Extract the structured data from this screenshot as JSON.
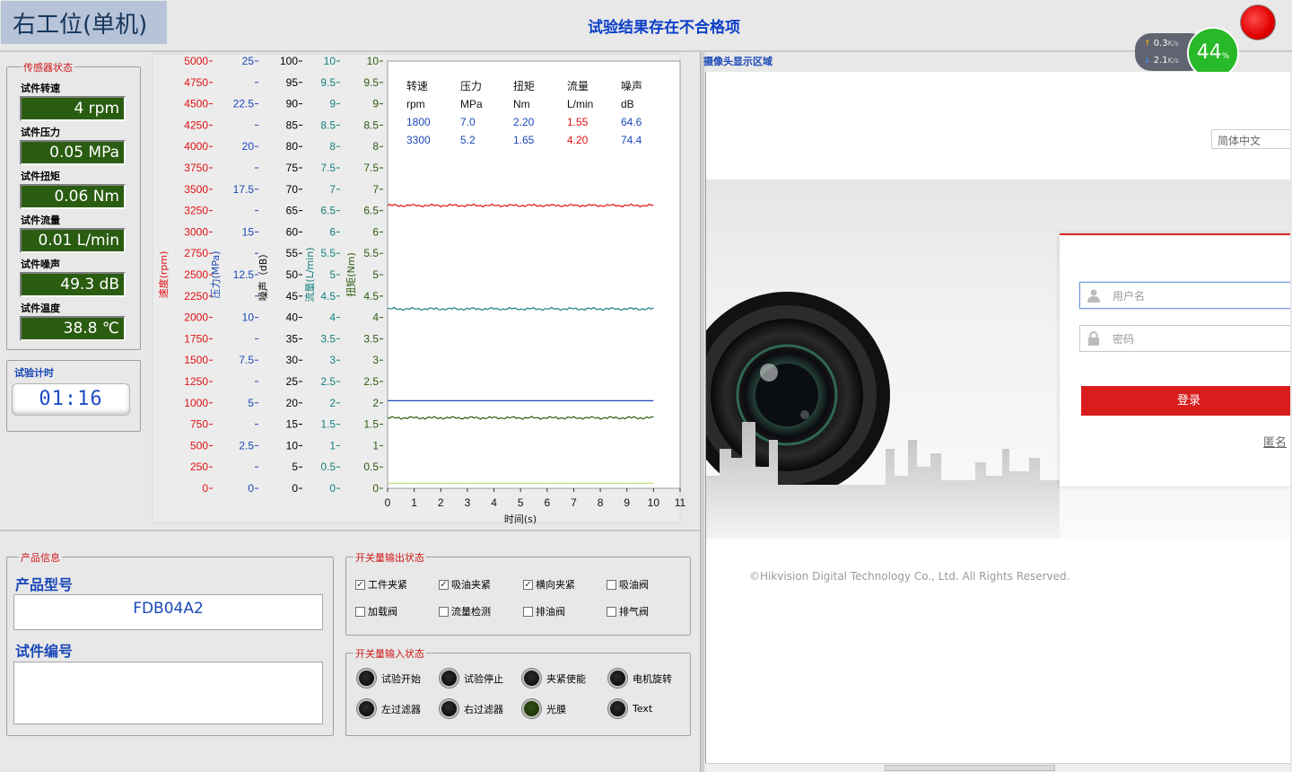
{
  "header": {
    "title": "右工位(单机)",
    "result_message": "试验结果存在不合格项"
  },
  "net_widget": {
    "up": "0.3",
    "up_unit": "K/s",
    "down": "2.1",
    "down_unit": "K/s",
    "percent": "44",
    "percent_unit": "%"
  },
  "sensor": {
    "legend": "传感器状态",
    "items": [
      {
        "label": "试件转速",
        "value": "4 rpm"
      },
      {
        "label": "试件压力",
        "value": "0.05 MPa"
      },
      {
        "label": "试件扭矩",
        "value": "0.06 Nm"
      },
      {
        "label": "试件流量",
        "value": "0.01 L/min"
      },
      {
        "label": "试件噪声",
        "value": "49.3 dB"
      },
      {
        "label": "试件温度",
        "value": "38.8 ℃"
      }
    ]
  },
  "timer": {
    "label": "试验计时",
    "value": "01:16"
  },
  "chart_data": {
    "type": "line",
    "xlabel": "时间(s)",
    "xlim": [
      0,
      11
    ],
    "x_ticks": [
      "0",
      "1",
      "2",
      "3",
      "4",
      "5",
      "6",
      "7",
      "8",
      "9",
      "10",
      "11"
    ],
    "axes": [
      {
        "label": "速度(rpm)",
        "color": "#e01010",
        "min": 0,
        "max": 5000,
        "ticks": [
          "5000",
          "4750",
          "4500",
          "4250",
          "4000",
          "3750",
          "3500",
          "3250",
          "3000",
          "2750",
          "2500",
          "2250",
          "2000",
          "1750",
          "1500",
          "1250",
          "1000",
          "750",
          "500",
          "250",
          "0"
        ]
      },
      {
        "label": "压力(MPa)",
        "color": "#1a48b8",
        "min": 0,
        "max": 25,
        "ticks": [
          "25",
          "",
          "22.5",
          "",
          "20",
          "",
          "17.5",
          "",
          "15",
          "",
          "12.5",
          "",
          "10",
          "",
          "7.5",
          "",
          "5",
          "",
          "2.5",
          "",
          "0"
        ]
      },
      {
        "label": "噪声（dB）",
        "color": "#000000",
        "min": 0,
        "max": 100,
        "ticks": [
          "100",
          "95",
          "90",
          "85",
          "80",
          "75",
          "70",
          "65",
          "60",
          "55",
          "50",
          "45",
          "40",
          "35",
          "30",
          "25",
          "20",
          "15",
          "10",
          "5",
          "0"
        ]
      },
      {
        "label": "流量(L/min)",
        "color": "#168080",
        "min": 0,
        "max": 10,
        "ticks": [
          "10",
          "9.5",
          "9",
          "8.5",
          "8",
          "7.5",
          "7",
          "6.5",
          "6",
          "5.5",
          "5",
          "4.5",
          "4",
          "3.5",
          "3",
          "2.5",
          "2",
          "1.5",
          "1",
          "0.5",
          "0"
        ]
      },
      {
        "label": "扭矩(Nm)",
        "color": "#2c5a10",
        "min": 0,
        "max": 10,
        "ticks": [
          "10",
          "9.5",
          "9",
          "8.5",
          "8",
          "7.5",
          "7",
          "6.5",
          "6",
          "5.5",
          "5",
          "4.5",
          "4",
          "3.5",
          "3",
          "2.5",
          "2",
          "1.5",
          "1",
          "0.5",
          "0"
        ]
      }
    ],
    "series": [
      {
        "color": "#e01010",
        "axis": 3,
        "x": [
          0,
          10
        ],
        "y": [
          6.62,
          6.62
        ],
        "noisy": true
      },
      {
        "color": "#168080",
        "axis": 3,
        "x": [
          0,
          10
        ],
        "y": [
          4.2,
          4.2
        ],
        "noisy": true
      },
      {
        "color": "#1a48b8",
        "axis": 3,
        "x": [
          0,
          10
        ],
        "y": [
          2.05,
          2.05
        ],
        "noisy": false
      },
      {
        "color": "#2c5a10",
        "axis": 3,
        "x": [
          0,
          10
        ],
        "y": [
          1.65,
          1.65
        ],
        "noisy": true
      },
      {
        "color": "#b8e070",
        "axis": 3,
        "x": [
          0,
          10
        ],
        "y": [
          0.12,
          0.12
        ],
        "noisy": false
      }
    ],
    "table": {
      "headers": [
        "转速",
        "压力",
        "扭矩",
        "流量",
        "噪声"
      ],
      "units": [
        "rpm",
        "MPa",
        "Nm",
        "L/min",
        "dB"
      ],
      "rows": [
        [
          "1800",
          "7.0",
          "2.20",
          "1.55",
          "64.6"
        ],
        [
          "3300",
          "5.2",
          "1.65",
          "4.20",
          "74.4"
        ]
      ],
      "colors": [
        "#1a48b8",
        "#1a48b8",
        "#1a48b8",
        "#e01010",
        "#1a48b8"
      ]
    },
    "grid": false
  },
  "product": {
    "legend": "产品信息",
    "model_label": "产品型号",
    "model_value": "FDB04A2",
    "serial_label": "试件编号",
    "serial_value": ""
  },
  "outputs": {
    "legend": "开关量输出状态",
    "items": [
      {
        "label": "工件夹紧",
        "checked": true
      },
      {
        "label": "吸油夹紧",
        "checked": true
      },
      {
        "label": "横向夹紧",
        "checked": true
      },
      {
        "label": "吸油阀",
        "checked": false
      },
      {
        "label": "加载阀",
        "checked": false
      },
      {
        "label": "流量检测",
        "checked": false
      },
      {
        "label": "排油阀",
        "checked": false
      },
      {
        "label": "排气阀",
        "checked": false
      }
    ]
  },
  "inputs": {
    "legend": "开关量输入状态",
    "items": [
      {
        "label": "试验开始",
        "on": false
      },
      {
        "label": "试验停止",
        "on": false
      },
      {
        "label": "夹紧使能",
        "on": false
      },
      {
        "label": "电机旋转",
        "on": false
      },
      {
        "label": "左过滤器",
        "on": false
      },
      {
        "label": "右过滤器",
        "on": false
      },
      {
        "label": "光膜",
        "on": true
      },
      {
        "label": "Text",
        "on": false
      }
    ]
  },
  "camera": {
    "label": "摄像头显示区域",
    "language": "简体中文",
    "username_placeholder": "用户名",
    "password_placeholder": "密码",
    "login_label": "登录",
    "anonymous_label": "匿名",
    "copyright": "©Hikvision Digital Technology Co., Ltd. All Rights Reserved."
  }
}
